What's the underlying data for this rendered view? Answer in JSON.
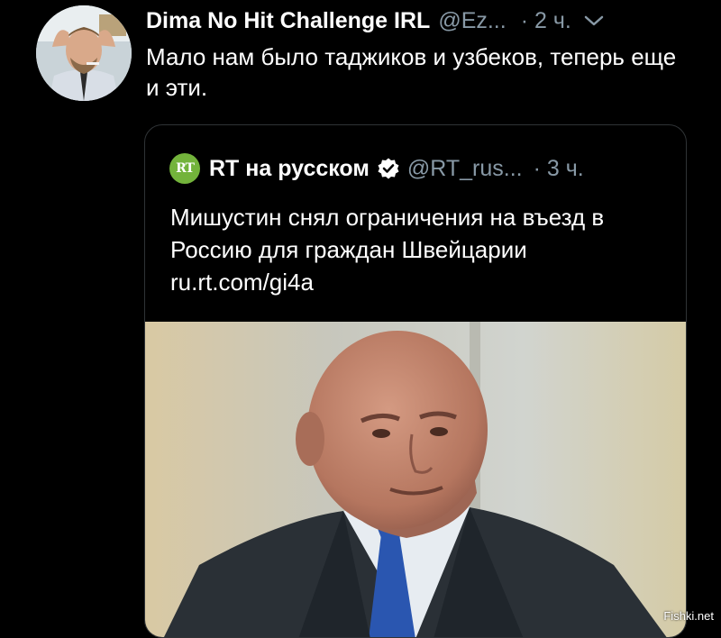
{
  "tweet": {
    "display_name": "Dima No Hit Challenge IRL",
    "handle": "@Ez...",
    "time": "· 2 ч.",
    "text": "Мало нам было таджиков и узбеков, теперь еще и эти.",
    "avatar_icon": "user-avatar",
    "menu_icon": "chevron-down-icon"
  },
  "quote": {
    "logo_text": "RT",
    "display_name": "RT на русском",
    "handle": "@RT_rus...",
    "time": "· 3 ч.",
    "text": "Мишустин снял ограничения на въезд в Россию для граждан Швейцарии ru.rt.com/gi4a",
    "verified_icon": "verified-badge-icon",
    "image_subject": "man in suit with blue tie"
  },
  "watermark": "Fishki.net",
  "colors": {
    "background": "#000000",
    "text": "#ffffff",
    "secondary": "#8899a6",
    "border": "#2f3336",
    "rt_green": "#73b33b"
  }
}
